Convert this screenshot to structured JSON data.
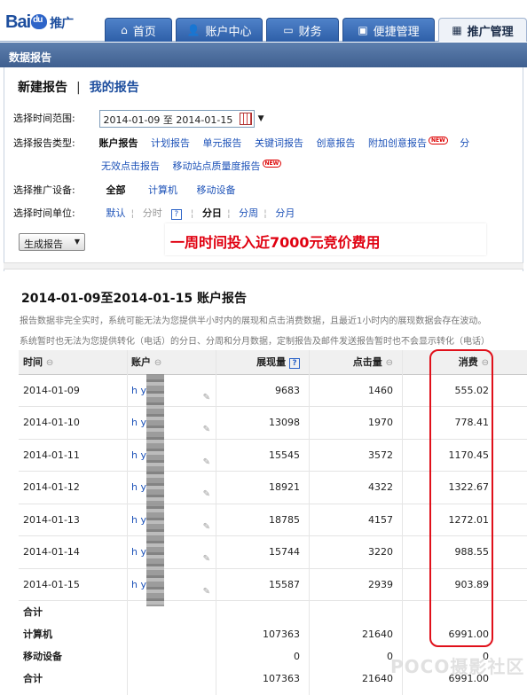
{
  "brand": {
    "logo_a": "Bai",
    "logo_b": "推广"
  },
  "nav_tabs": [
    {
      "label": "首页",
      "icon": "home-icon"
    },
    {
      "label": "账户中心",
      "icon": "user-icon"
    },
    {
      "label": "财务",
      "icon": "wallet-icon"
    },
    {
      "label": "便捷管理",
      "icon": "tools-icon"
    },
    {
      "label": "推广管理",
      "icon": "grid-icon"
    }
  ],
  "section_header": "数据报告",
  "subtabs": {
    "new": "新建报告",
    "sep": "|",
    "mine": "我的报告"
  },
  "time_range": {
    "label": "选择时间范围:",
    "value": "2014-01-09 至 2014-01-15"
  },
  "report_type": {
    "label": "选择报告类型:",
    "items": [
      "账户报告",
      "计划报告",
      "单元报告",
      "关键词报告",
      "创意报告",
      "附加创意报告",
      "分"
    ],
    "items2": [
      "无效点击报告",
      "移动站点质量度报告"
    ],
    "new_badge": "NEW"
  },
  "device": {
    "label": "选择推广设备:",
    "items": [
      "全部",
      "计算机",
      "移动设备"
    ]
  },
  "unit": {
    "label": "选择时间单位:",
    "items": [
      "默认",
      "分时",
      "分日",
      "分周",
      "分月"
    ],
    "help": "?"
  },
  "generate_button": "生成报告",
  "promo_text": "一周时间投入近7000元竞价费用",
  "report": {
    "title": "2014-01-09至2014-01-15 账户报告",
    "note1": "报告数据非完全实时，系统可能无法为您提供半小时内的展现和点击消费数据，且最近1小时内的展现数据会存在波动。",
    "note2": "系统暂时也无法为您提供转化（电话）的分日、分周和分月数据，定制报告及邮件发送报告暂时也不会显示转化（电话）"
  },
  "table": {
    "headers": [
      "时间",
      "账户",
      "展现量",
      "点击量",
      "消费"
    ],
    "help": "?",
    "rows": [
      {
        "date": "2014-01-09",
        "account": "h      y",
        "impressions": "9683",
        "clicks": "1460",
        "cost": "555.02"
      },
      {
        "date": "2014-01-10",
        "account": "h      y",
        "impressions": "13098",
        "clicks": "1970",
        "cost": "778.41"
      },
      {
        "date": "2014-01-11",
        "account": "h      y",
        "impressions": "15545",
        "clicks": "3572",
        "cost": "1170.45"
      },
      {
        "date": "2014-01-12",
        "account": "h      y",
        "impressions": "18921",
        "clicks": "4322",
        "cost": "1322.67"
      },
      {
        "date": "2014-01-13",
        "account": "h      y",
        "impressions": "18785",
        "clicks": "4157",
        "cost": "1272.01"
      },
      {
        "date": "2014-01-14",
        "account": "h      y",
        "impressions": "15744",
        "clicks": "3220",
        "cost": "988.55"
      },
      {
        "date": "2014-01-15",
        "account": "h      y",
        "impressions": "15587",
        "clicks": "2939",
        "cost": "903.89"
      }
    ],
    "totals": [
      {
        "label": "合计",
        "impressions": "",
        "clicks": "",
        "cost": ""
      },
      {
        "label": "计算机",
        "impressions": "107363",
        "clicks": "21640",
        "cost": "6991.00"
      },
      {
        "label": "移动设备",
        "impressions": "0",
        "clicks": "0",
        "cost": "0"
      },
      {
        "label": "合计",
        "impressions": "107363",
        "clicks": "21640",
        "cost": "6991.00"
      }
    ]
  },
  "watermark": "POCO摄影社区",
  "colors": {
    "brand_blue": "#1d4e9e",
    "tab_blue": "#2e5fa8",
    "highlight_red": "#e0101a"
  }
}
